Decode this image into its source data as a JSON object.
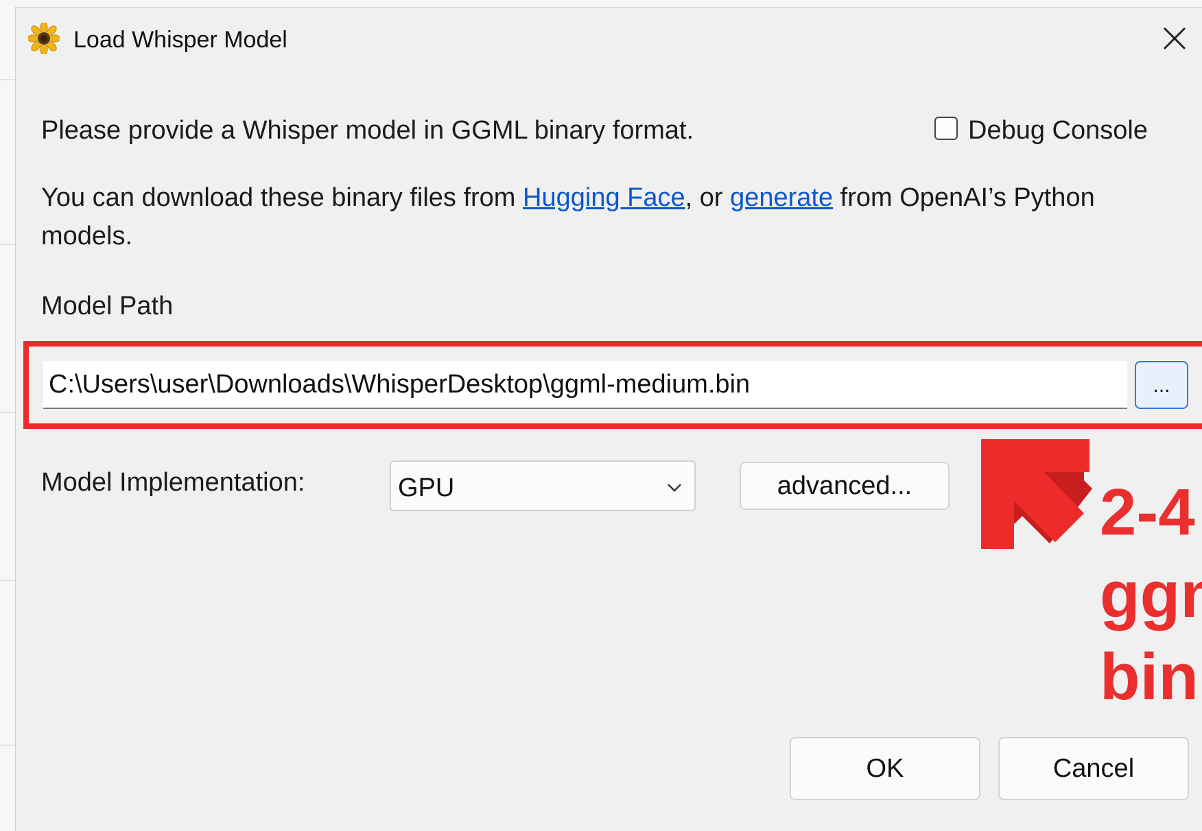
{
  "dialog": {
    "title": "Load Whisper Model",
    "intro": "Please provide a Whisper model in GGML binary format.",
    "debug_console_label": "Debug Console",
    "debug_console_checked": false,
    "download_text_before": "You can download these binary files from ",
    "link_huggingface": "Hugging Face",
    "download_text_mid": ", or ",
    "link_generate": "generate",
    "download_text_after": " from OpenAI’s Python",
    "download_text_line2": "models.",
    "model_path_label": "Model Path",
    "model_path_value": "C:\\Users\\user\\Downloads\\WhisperDesktop\\ggml-medium.bin",
    "browse_label": "...",
    "impl_label": "Model Implementation:",
    "impl_value": "GPU",
    "advanced_label": "advanced...",
    "ok_label": "OK",
    "cancel_label": "Cancel"
  },
  "annotation": {
    "lines": [
      "2-4",
      "ggm",
      "bin"
    ],
    "color": "#ea2f2f"
  },
  "icons": {
    "app": "sunflower-icon",
    "close": "close-icon",
    "combo": "chevron-down-icon",
    "annotation": "arrow-up-left-icon"
  },
  "colors": {
    "link": "#0b57d0",
    "highlight": "#ee2b2b",
    "browse_border": "#2f7ae0"
  }
}
